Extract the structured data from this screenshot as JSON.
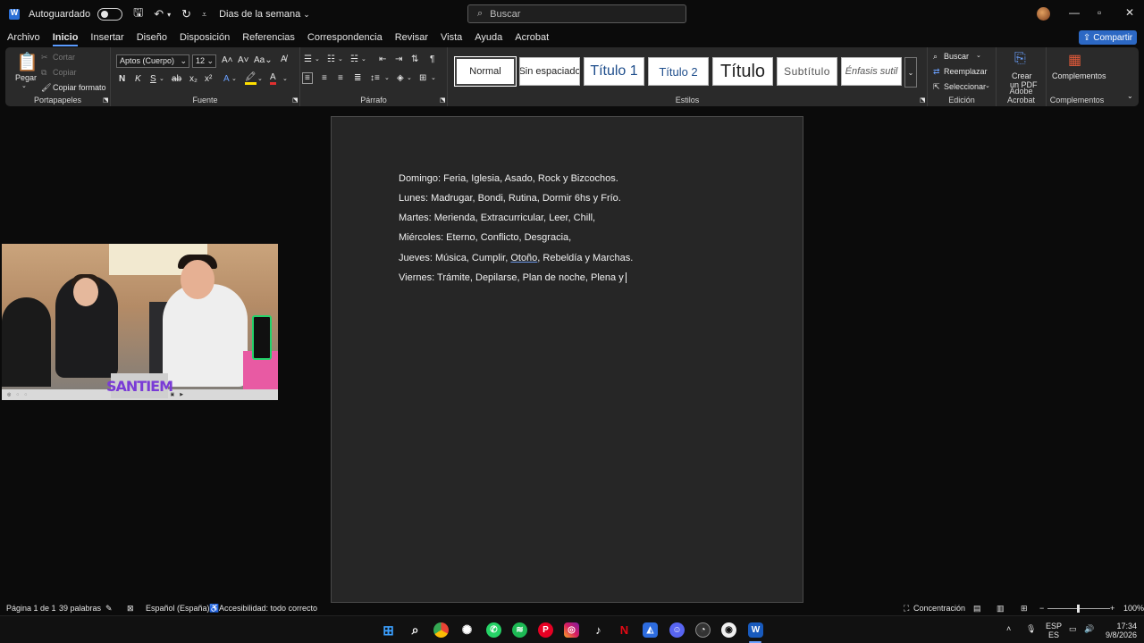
{
  "titlebar": {
    "autosave_label": "Autoguardado",
    "doc_title": "Dias de la semana",
    "search_placeholder": "Buscar"
  },
  "tabs": [
    "Archivo",
    "Inicio",
    "Insertar",
    "Diseño",
    "Disposición",
    "Referencias",
    "Correspondencia",
    "Revisar",
    "Vista",
    "Ayuda",
    "Acrobat"
  ],
  "share_label": "Compartir",
  "ribbon": {
    "clipboard": {
      "paste": "Pegar",
      "cut": "Cortar",
      "copy": "Copiar",
      "format_painter": "Copiar formato",
      "label": "Portapapeles"
    },
    "font": {
      "family": "Aptos (Cuerpo)",
      "size": "12",
      "label": "Fuente"
    },
    "paragraph": {
      "label": "Párrafo"
    },
    "styles": {
      "items": [
        "Normal",
        "Sin espaciado",
        "Título 1",
        "Título 2",
        "Título",
        "Subtítulo",
        "Énfasis sutil"
      ],
      "label": "Estilos"
    },
    "editing": {
      "find": "Buscar",
      "replace": "Reemplazar",
      "select": "Seleccionar",
      "label": "Edición"
    },
    "acrobat": {
      "create_pdf_1": "Crear",
      "create_pdf_2": "un PDF",
      "label": "Adobe Acrobat"
    },
    "addins": {
      "button": "Complementos",
      "label": "Complementos"
    }
  },
  "document": {
    "lines": [
      "Domingo: Feria, Iglesia, Asado, Rock y Bizcochos.",
      "Lunes: Madrugar, Bondi, Rutina, Dormir 6hs y Frío.",
      "Martes: Merienda, Extracurricular, Leer, Chill,",
      "Miércoles: Eterno, Conflicto, Desgracia,",
      "Viernes: Trámite, Depilarse, Plan de noche, Plena y"
    ],
    "jueves_pre": "Jueves: Música, Cumplir, ",
    "jueves_word": "Otoño",
    "jueves_post": ", Rebeldía y Marchas."
  },
  "webcam": {
    "logo": "SANTIEM"
  },
  "statusbar": {
    "page": "Página 1 de 1",
    "words": "39 palabras",
    "language": "Español (España)",
    "accessibility": "Accesibilidad: todo correcto",
    "focus": "Concentración",
    "zoom": "100%"
  },
  "taskbar": {
    "lang_1": "ESP",
    "lang_2": "ES",
    "time": "17:34",
    "date": "9/8/2026"
  }
}
